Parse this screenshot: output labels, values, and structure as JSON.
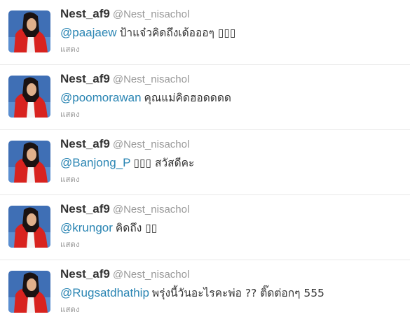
{
  "tweets": [
    {
      "fullname": "Nest_af9",
      "username": "@Nest_nisachol",
      "mention": "@paajaew",
      "text": "ป้าแจ๋วคิดถึงเด้อออๆ ▯▯▯",
      "expand_label": "แสดง"
    },
    {
      "fullname": "Nest_af9",
      "username": "@Nest_nisachol",
      "mention": "@poomorawan",
      "text": "คุณแม่คิดฮอดดดด",
      "expand_label": "แสดง"
    },
    {
      "fullname": "Nest_af9",
      "username": "@Nest_nisachol",
      "mention": "@Banjong_P",
      "text": "▯▯▯ สวัสดีคะ",
      "expand_label": "แสดง"
    },
    {
      "fullname": "Nest_af9",
      "username": "@Nest_nisachol",
      "mention": "@krungor",
      "text": "คิดถึง ▯▯",
      "expand_label": "แสดง"
    },
    {
      "fullname": "Nest_af9",
      "username": "@Nest_nisachol",
      "mention": "@Rugsatdhathip",
      "text": "พรุ่งนี้วันอะไรคะพ่อ ?? ติ๊ดต่อกๆ 555",
      "expand_label": "แสดง"
    }
  ],
  "colors": {
    "mention": "#2a85b3",
    "muted": "#999999",
    "text": "#333333",
    "divider": "#e8e8e8"
  }
}
